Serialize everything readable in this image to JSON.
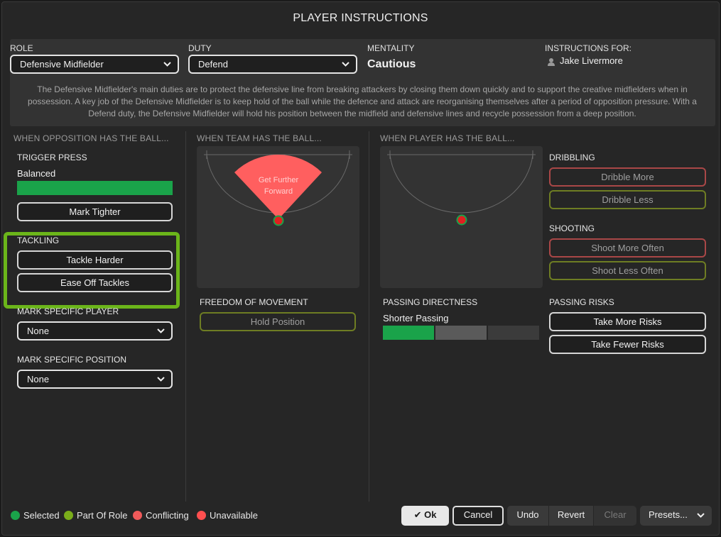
{
  "title": "PLAYER INSTRUCTIONS",
  "header": {
    "role_label": "ROLE",
    "role_value": "Defensive Midfielder",
    "duty_label": "DUTY",
    "duty_value": "Defend",
    "mentality_label": "MENTALITY",
    "mentality_value": "Cautious",
    "instructions_for_label": "INSTRUCTIONS FOR:",
    "player_name": "Jake Livermore",
    "description": "The Defensive Midfielder's main duties are to protect the defensive line from breaking attackers by closing them down quickly and to support the creative midfielders when in possession. A key job of the Defensive Midfielder is to keep hold of the ball while the defence and attack are reorganising themselves after a period of opposition pressure. With a Defend duty, the Defensive Midfielder will hold his position between the midfield and defensive lines and recycle possession from a deep position."
  },
  "opposition": {
    "heading": "WHEN OPPOSITION HAS THE BALL...",
    "trigger_press_label": "TRIGGER PRESS",
    "trigger_press_value": "Balanced",
    "trigger_press_level": 1.0,
    "mark_tighter": "Mark Tighter",
    "tackling_label": "TACKLING",
    "tackle_harder": "Tackle Harder",
    "ease_off_tackles": "Ease Off Tackles",
    "mark_player_label": "MARK SPECIFIC PLAYER",
    "mark_player_value": "None",
    "mark_position_label": "MARK SPECIFIC POSITION",
    "mark_position_value": "None"
  },
  "team_ball": {
    "heading": "WHEN TEAM HAS THE BALL...",
    "zone_label_line1": "Get Further",
    "zone_label_line2": "Forward",
    "freedom_label": "FREEDOM OF MOVEMENT",
    "hold_position": "Hold Position"
  },
  "player_ball": {
    "heading": "WHEN PLAYER HAS THE BALL...",
    "passing_directness_label": "PASSING DIRECTNESS",
    "passing_directness_value": "Shorter Passing",
    "passing_directness_level": 1,
    "passing_directness_steps": 3,
    "dribbling_label": "DRIBBLING",
    "dribble_more": "Dribble More",
    "dribble_less": "Dribble Less",
    "shooting_label": "SHOOTING",
    "shoot_more": "Shoot More Often",
    "shoot_less": "Shoot Less Often",
    "passing_risks_label": "PASSING RISKS",
    "take_more_risks": "Take More Risks",
    "take_fewer_risks": "Take Fewer Risks"
  },
  "legend": {
    "selected": "Selected",
    "part_of_role": "Part Of Role",
    "conflicting": "Conflicting",
    "unavailable": "Unavailable"
  },
  "footer": {
    "ok": "Ok",
    "cancel": "Cancel",
    "undo": "Undo",
    "revert": "Revert",
    "clear": "Clear",
    "presets": "Presets..."
  },
  "colors": {
    "selected": "#1aa34a",
    "part_of_role": "#7aad1a",
    "conflicting": "#f05a5a",
    "unavailable": "#ff4f4f",
    "zone": "#ff5f5f",
    "highlight": "#6bb51a"
  }
}
